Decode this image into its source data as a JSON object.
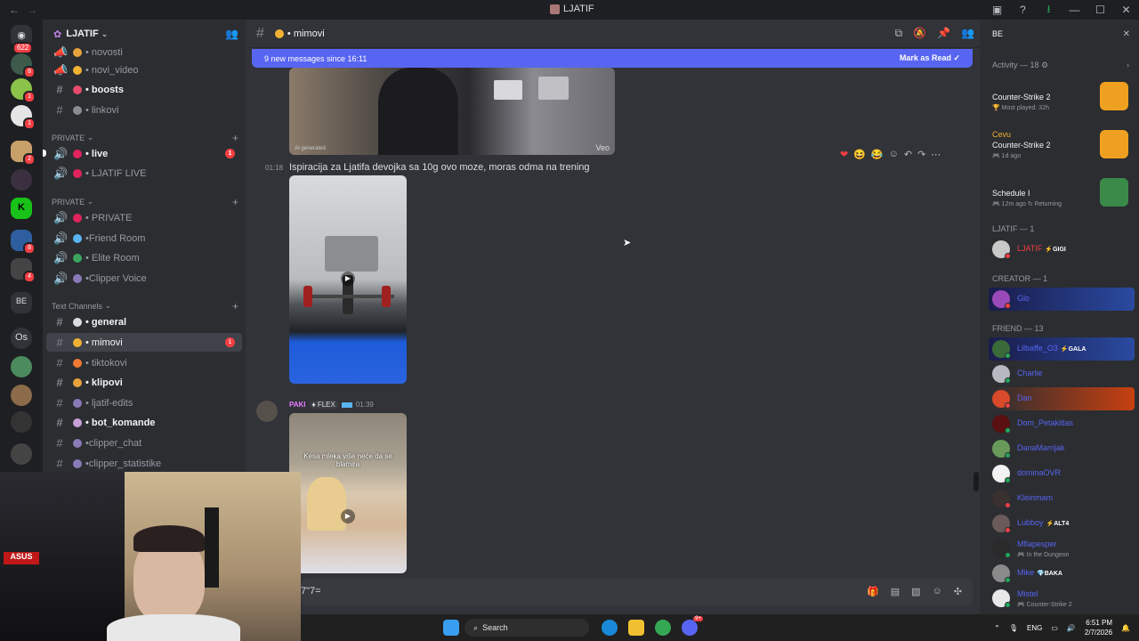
{
  "titlebar": {
    "title": "LJATIF"
  },
  "rail": {
    "home_badge": "622",
    "badges": [
      "8",
      "1",
      "1",
      "2",
      "8",
      "4"
    ],
    "os_label": "Os"
  },
  "sidebar": {
    "guild_name": "LJATIF",
    "channels": [
      {
        "name": "• novosti"
      },
      {
        "name": "• novi_video"
      },
      {
        "name": "• boosts"
      },
      {
        "name": "• linkovi"
      }
    ],
    "cat_private1": "PRIVATE",
    "private1": [
      {
        "name": "• live",
        "unread": "1"
      },
      {
        "name": "• LJATIF LIVE"
      }
    ],
    "cat_private2": "PRIVATE",
    "private2": [
      {
        "name": "• PRIVATE"
      },
      {
        "name": "•Friend Room"
      },
      {
        "name": "• Elite Room"
      },
      {
        "name": "•Clipper Voice"
      }
    ],
    "cat_text": "Text Channels",
    "text": [
      {
        "name": "• general"
      },
      {
        "name": "• mimovi",
        "unread": "1"
      },
      {
        "name": "• tiktokovi"
      },
      {
        "name": "• klipovi"
      },
      {
        "name": "• ljatif-edits"
      },
      {
        "name": "• bot_komande"
      },
      {
        "name": "•clipper_chat"
      },
      {
        "name": "•clipper_statistike"
      }
    ]
  },
  "main": {
    "channel_name": "• mimovi",
    "newbar_text": "9 new messages since 16:11",
    "mark_as_read": "Mark as Read",
    "video1_label": "AI-generated",
    "video1_veo": "Veo",
    "msg1_time": "01:18",
    "msg1_text": "Ispiracija za Ljatifa devojka sa 10g ovo moze, moras odma na trening",
    "msg2_user": "PAKI",
    "msg2_tag": "FLEX",
    "msg2_time": "01:39",
    "msg2_caption": "Kesa mleka više neće da se blamira",
    "composer_value": "7\"7="
  },
  "members": {
    "search_value": "BE",
    "activity_header": "Activity — 18",
    "activities": [
      {
        "name": "",
        "game": "Counter-Strike 2",
        "meta": "Most played: 32h"
      },
      {
        "name": "Cevu",
        "game": "Counter-Strike 2",
        "meta": "1d ago"
      },
      {
        "name": "",
        "game": "Schedule I",
        "meta": "12m ago  ↻ Returning"
      }
    ],
    "sec_ljatif": "LJATIF — 1",
    "ljatif_member": {
      "name": "LJATIF",
      "badge": "GIGI"
    },
    "sec_creator": "CREATOR — 1",
    "creator_member": {
      "name": "Glo"
    },
    "sec_friend": "FRIEND — 13",
    "friends": [
      {
        "name": "Lilbaffe_O3",
        "badge": "GALA",
        "sub": ""
      },
      {
        "name": "Charlie",
        "badge": "",
        "sub": ""
      },
      {
        "name": "Dan",
        "badge": "",
        "sub": ""
      },
      {
        "name": "Dom_Petakitlas",
        "badge": "",
        "sub": ""
      },
      {
        "name": "DanaMarrijak",
        "badge": "",
        "sub": ""
      },
      {
        "name": "dominaOVR",
        "badge": "",
        "sub": ""
      },
      {
        "name": "Kleinmam",
        "badge": "",
        "sub": ""
      },
      {
        "name": "Lubboy",
        "badge": "ALT4",
        "sub": ""
      },
      {
        "name": "Mflapesper",
        "badge": "",
        "sub": "In the Dungeon"
      },
      {
        "name": "Mike",
        "badge": "BAKA",
        "sub": ""
      },
      {
        "name": "Mistel",
        "badge": "",
        "sub": "Counter-Strike 2"
      }
    ]
  },
  "taskbar": {
    "search_label": "Search",
    "lang": "ENG",
    "time": "6:51 PM",
    "date": "2/7/2026",
    "discord_badge": "9+"
  },
  "colors": {
    "accent": "#5865f2",
    "danger": "#f23f43",
    "online": "#23a55a"
  }
}
